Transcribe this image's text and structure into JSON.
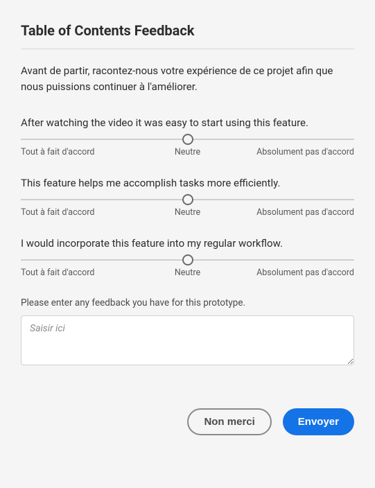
{
  "title": "Table of Contents Feedback",
  "intro": "Avant de partir, racontez-nous votre expérience de ce projet afin que nous puissions continuer à l'améliorer.",
  "questions": [
    {
      "text": "After watching the video it was easy to start using this feature.",
      "labels": {
        "left": "Tout à fait d'accord",
        "center": "Neutre",
        "right": "Absolument pas d'accord"
      }
    },
    {
      "text": "This feature helps me accomplish tasks more efficiently.",
      "labels": {
        "left": "Tout à fait d'accord",
        "center": "Neutre",
        "right": "Absolument pas d'accord"
      }
    },
    {
      "text": "I would incorporate this feature into my regular workflow.",
      "labels": {
        "left": "Tout à fait d'accord",
        "center": "Neutre",
        "right": "Absolument pas d'accord"
      }
    }
  ],
  "feedback": {
    "label": "Please enter any feedback you have for this prototype.",
    "placeholder": "Saisir ici"
  },
  "buttons": {
    "secondary": "Non merci",
    "primary": "Envoyer"
  }
}
